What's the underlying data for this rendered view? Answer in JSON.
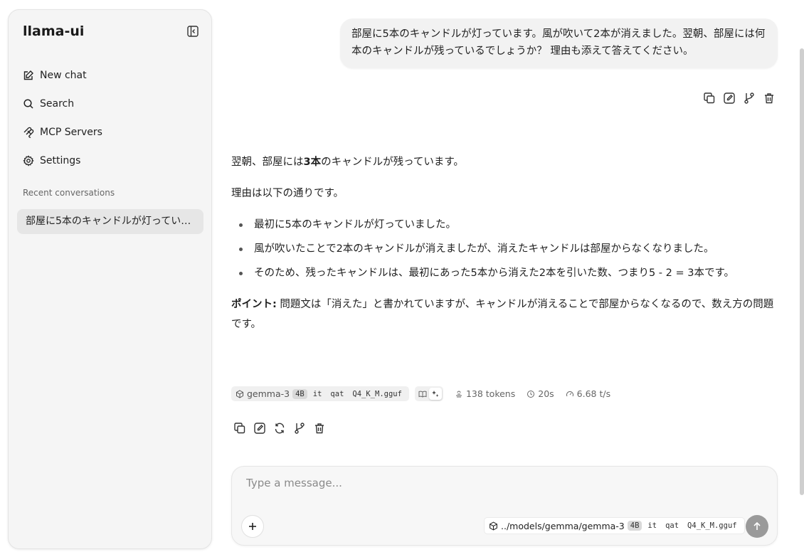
{
  "sidebar": {
    "brand": "llama-ui",
    "nav": [
      {
        "label": "New chat",
        "icon": "edit-icon"
      },
      {
        "label": "Search",
        "icon": "search-icon"
      },
      {
        "label": "MCP Servers",
        "icon": "mcp-icon"
      },
      {
        "label": "Settings",
        "icon": "gear-icon"
      }
    ],
    "recent_title": "Recent conversations",
    "conversations": [
      "部屋に5本のキャンドルが灯っています。風が吹いて2本が消えました。翌朝、部屋には何本のキャンドルが残っているでしょうか？ 理由も添えて答えてください。"
    ]
  },
  "user_message": "部屋に5本のキャンドルが灯っています。風が吹いて2本が消えました。翌朝、部屋には何本のキャンドルが残っているでしょうか？ 理由も添えて答えてください。",
  "answer": {
    "p1_before": "翌朝、部屋には",
    "p1_bold": "3本",
    "p1_after": "のキャンドルが残っています。",
    "p2": "理由は以下の通りです。",
    "bullets": [
      "最初に5本のキャンドルが灯っていました。",
      "風が吹いたことで2本のキャンドルが消えましたが、消えたキャンドルは部屋からなくなりました。",
      "そのため、残ったキャンドルは、最初にあった5本から消えた2本を引いた数、つまり5 - 2 = 3本です。"
    ],
    "point_label": "ポイント:",
    "point_text": " 問題文は「消えた」と書かれていますが、キャンドルが消えることで部屋からなくなるので、数え方の問題です。"
  },
  "meta": {
    "model_name": "gemma-3",
    "tags": [
      "4B",
      "it",
      "qat",
      "Q4_K_M.gguf"
    ],
    "tokens": "138 tokens",
    "time": "20s",
    "speed": "6.68 t/s"
  },
  "composer": {
    "placeholder": "Type a message...",
    "model_path": "../models/gemma/gemma-3",
    "tags": [
      "4B",
      "it",
      "qat",
      "Q4_K_M.gguf"
    ]
  }
}
